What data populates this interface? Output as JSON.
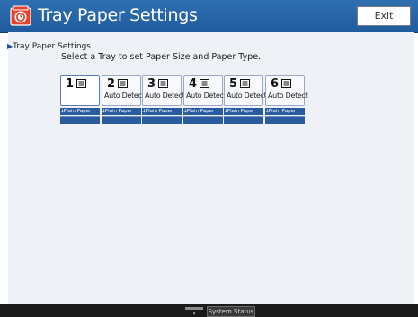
{
  "header": {
    "title": "Tray Paper Settings",
    "exit_label": "Exit",
    "icon": "copier-clock-icon"
  },
  "breadcrumb": {
    "marker": "▶",
    "text": "Tray Paper Settings"
  },
  "instruction": "Select a Tray to set Paper Size and Paper Type.",
  "trays": [
    {
      "number": "1",
      "mode": "",
      "paper": "‡Plain Paper"
    },
    {
      "number": "2",
      "mode": "Auto Detect",
      "paper": "‡Plain Paper"
    },
    {
      "number": "3",
      "mode": "Auto Detect",
      "paper": "‡Plain Paper"
    },
    {
      "number": "4",
      "mode": "Auto Detect",
      "paper": "‡Plain Paper"
    },
    {
      "number": "5",
      "mode": "Auto Detect",
      "paper": "‡Plain Paper"
    },
    {
      "number": "6",
      "mode": "Auto Detect",
      "paper": "‡Plain Paper"
    }
  ],
  "footer": {
    "system_status_label": "System Status",
    "counter_text": "▮"
  },
  "colors": {
    "header": "#1f5c9e",
    "tray_label_bg": "#2a5b9e",
    "panel_bg": "#eef1f6"
  }
}
